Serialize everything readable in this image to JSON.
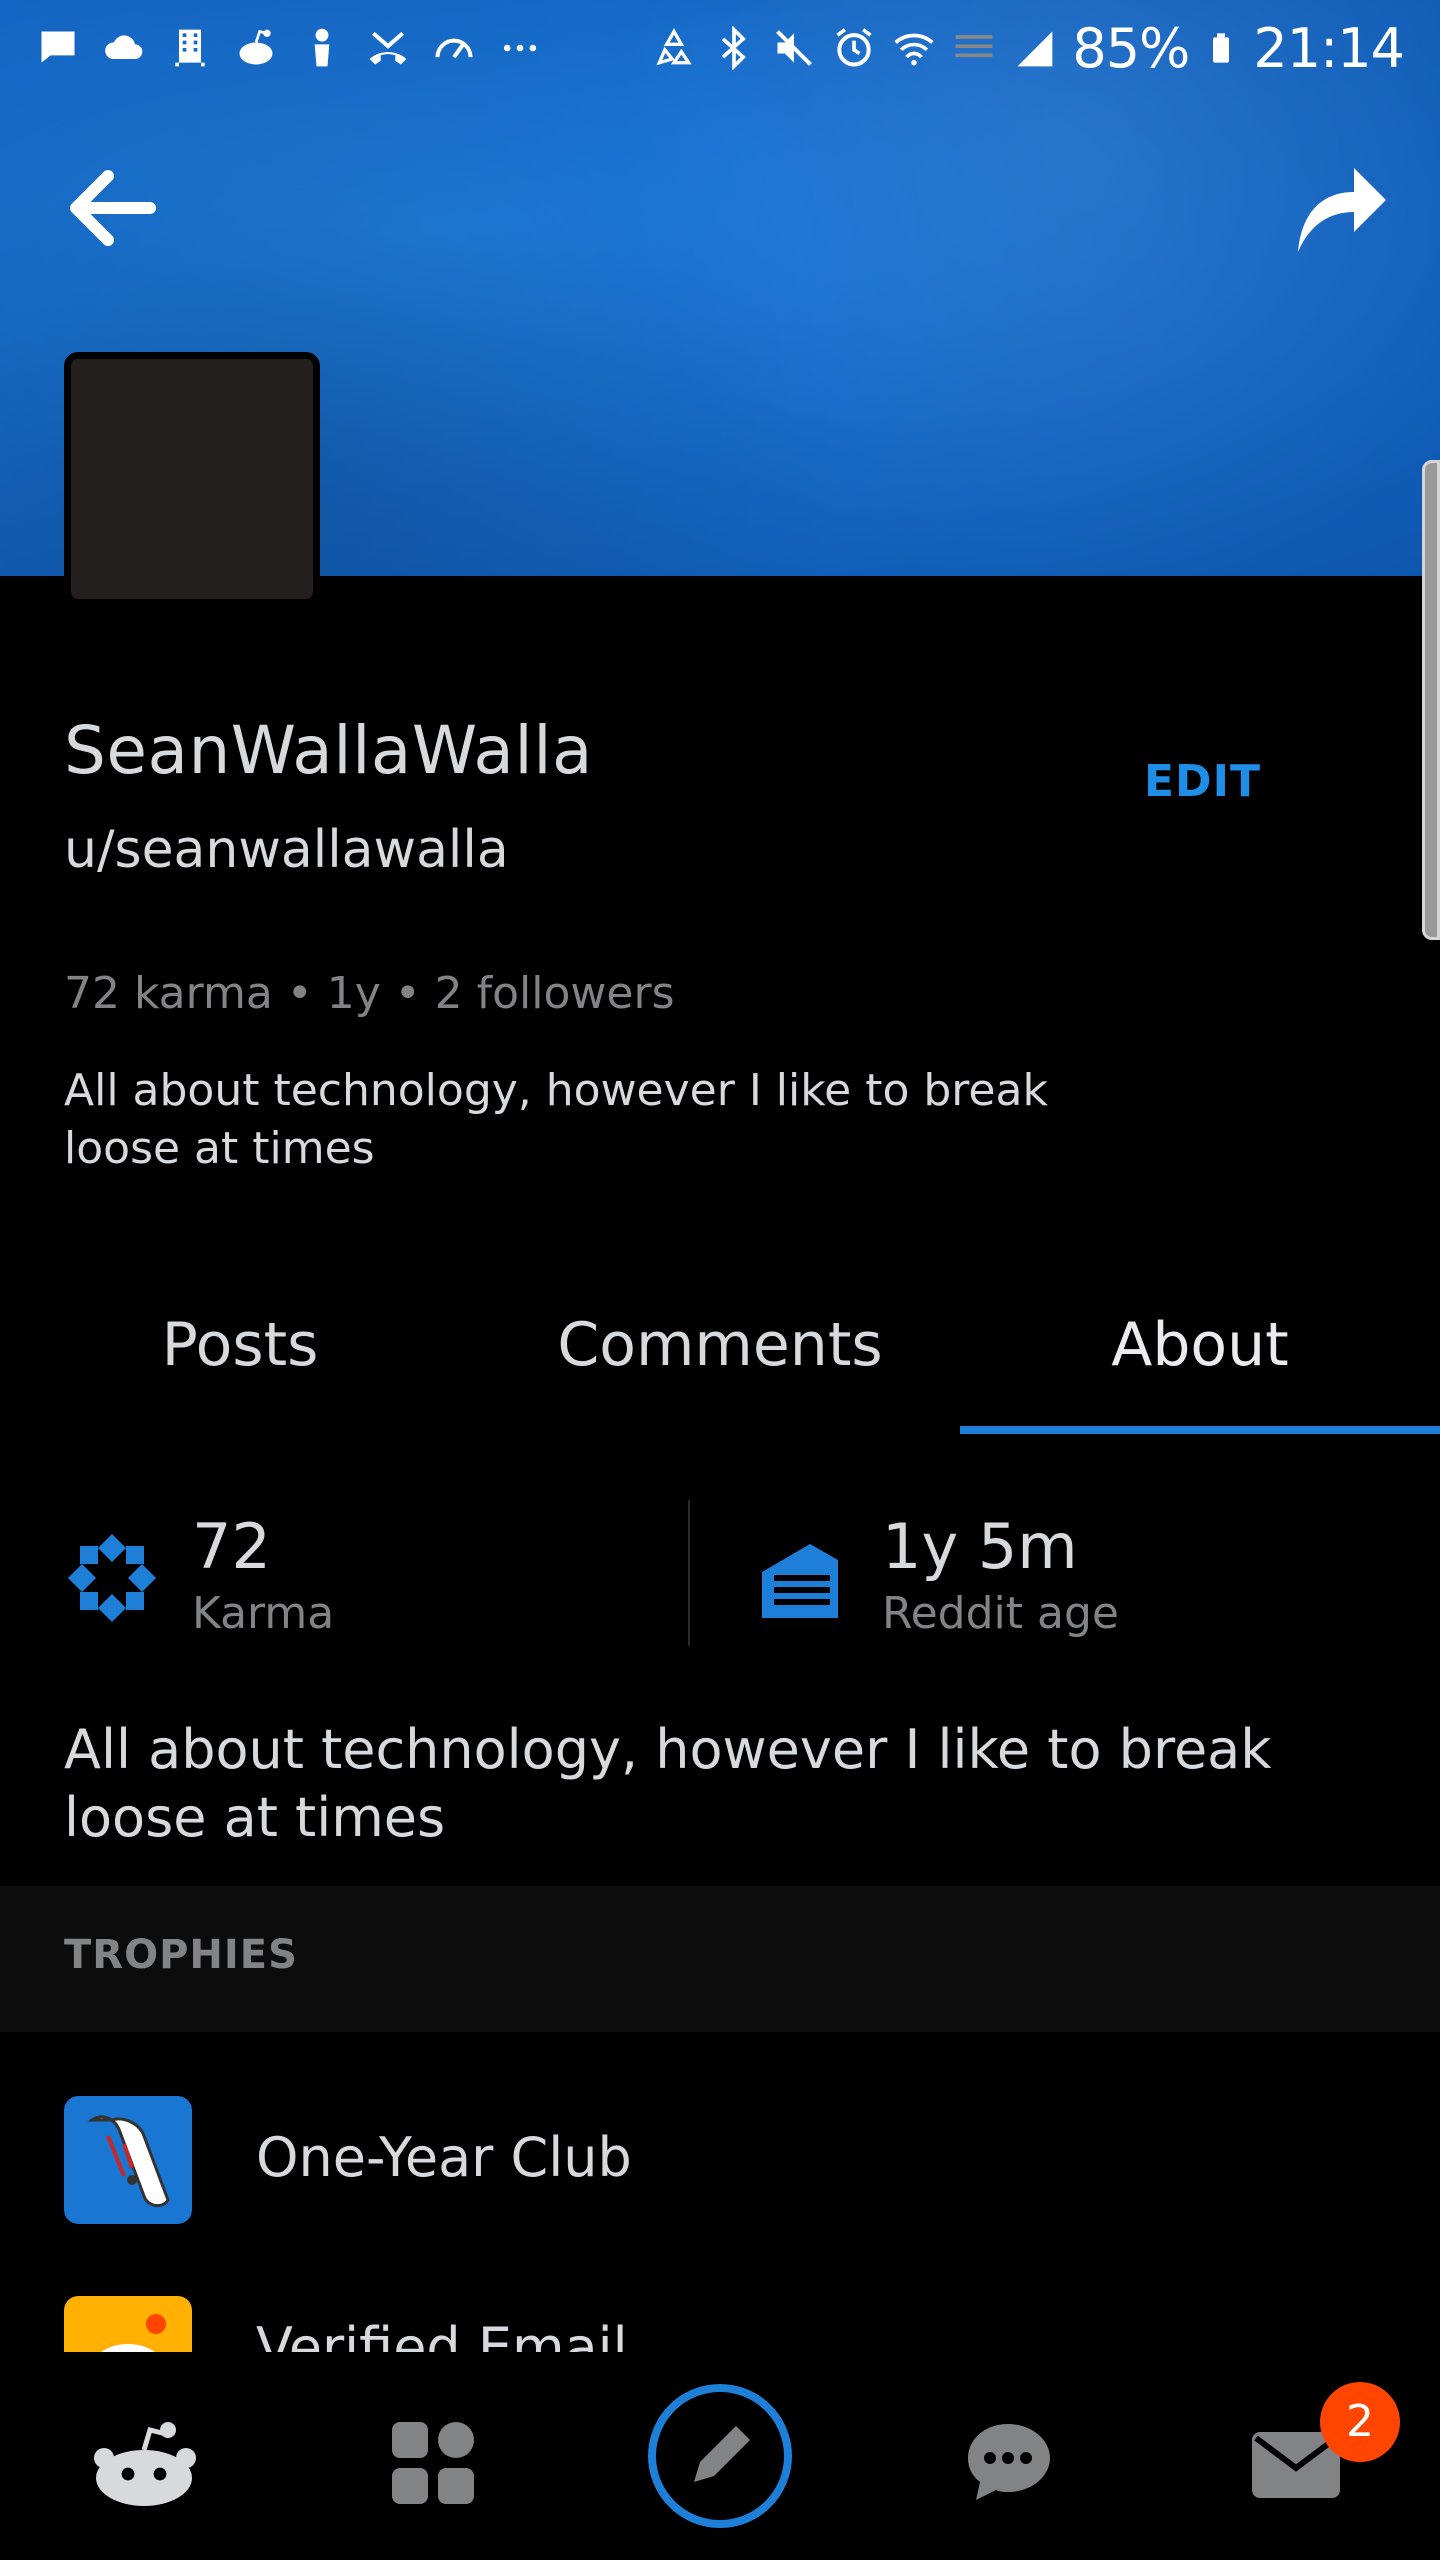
{
  "status_bar": {
    "battery": "85%",
    "time": "21:14",
    "left_icons": [
      "message-icon",
      "cloud-icon",
      "building-icon",
      "reddit-icon",
      "person-icon",
      "missed-call-icon",
      "speedometer-icon",
      "more-dots-icon"
    ],
    "right_icons": [
      "recycle-icon",
      "bluetooth-icon",
      "mute-icon",
      "alarm-icon",
      "wifi-icon",
      "lte-icon",
      "signal-icon",
      "battery-icon"
    ]
  },
  "header": {
    "back_icon": "arrow-left-icon",
    "share_icon": "share-arrow-icon"
  },
  "profile": {
    "display_name": "SeanWallaWalla",
    "username": "u/seanwallawalla",
    "edit_label": "EDIT",
    "stats_line": "72 karma • 1y • 2 followers",
    "bio": "All about technology, however I like to break loose at times"
  },
  "tabs": [
    {
      "label": "Posts",
      "active": false
    },
    {
      "label": "Comments",
      "active": false
    },
    {
      "label": "About",
      "active": true
    }
  ],
  "about": {
    "karma_value": "72",
    "karma_label": "Karma",
    "age_value": "1y 5m",
    "age_label": "Reddit age",
    "bio": "All about technology, however I like to break loose at times"
  },
  "trophies": {
    "header": "TROPHIES",
    "items": [
      {
        "name": "One-Year Club",
        "icon": "scroll-trophy-icon"
      },
      {
        "name": "Verified Email",
        "icon": "verified-email-trophy-icon"
      }
    ]
  },
  "bottom_nav": {
    "items": [
      "home-icon",
      "communities-icon",
      "create-post-icon",
      "chat-icon",
      "inbox-icon"
    ],
    "inbox_badge": "2"
  },
  "colors": {
    "banner": "#1466c4",
    "accent": "#1e8ee6",
    "badge": "#ff4500",
    "background": "#000000"
  }
}
